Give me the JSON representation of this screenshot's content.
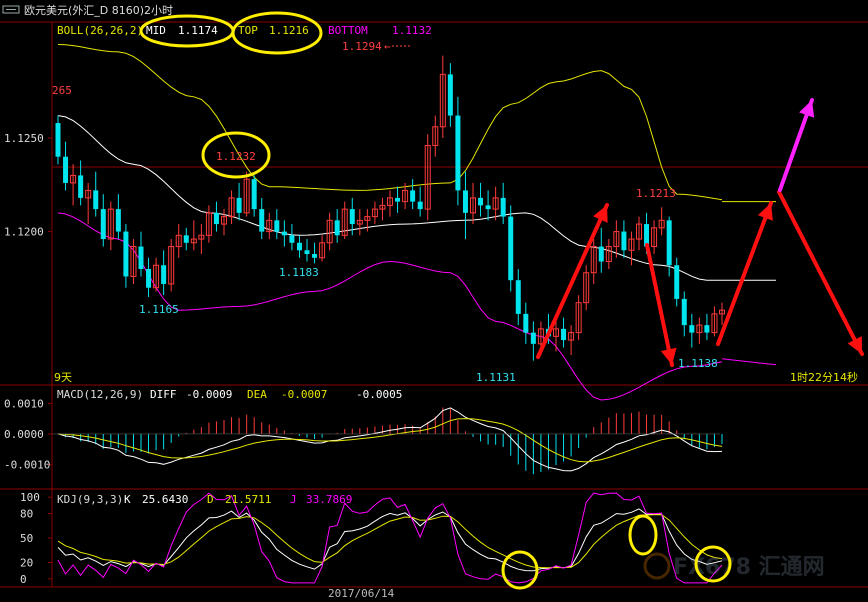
{
  "window": {
    "title": "欧元美元(外汇_D 8160)2小时",
    "icon": "window-toggle-icon"
  },
  "colors": {
    "background": "#000000",
    "panel_border": "#8b0000",
    "candle_up": "#ff3b3b",
    "candle_down": "#00e5ee",
    "boll_mid": "#ffffff",
    "boll_top": "#e6e600",
    "boll_bottom": "#ff00ff",
    "macd_diff": "#ffffff",
    "macd_dea": "#e6e600",
    "annotation": "#ffee00",
    "arrow_red": "#ff1010",
    "arrow_magenta": "#ff22ff"
  },
  "main_panel": {
    "indicator": "BOLL(26,26,2)",
    "mid_label": "MID",
    "mid_value": "1.1174",
    "top_label": "TOP",
    "top_value": "1.1216",
    "bottom_label": "BOTTOM",
    "bottom_value": "1.1132",
    "y_ticks": [
      "1.1250",
      "1.1200"
    ],
    "price_labels": [
      {
        "text": "1.1294",
        "kind": "high"
      },
      {
        "text": "265",
        "kind": "high"
      },
      {
        "text": "1.1232",
        "kind": "high"
      },
      {
        "text": "1.1213",
        "kind": "high"
      },
      {
        "text": "1.1183",
        "kind": "low"
      },
      {
        "text": "1.1165",
        "kind": "low"
      },
      {
        "text": "1.1131",
        "kind": "low"
      },
      {
        "text": "1.1138",
        "kind": "low"
      }
    ],
    "days_label": "9天",
    "countdown": "1时22分14秒",
    "high_marker_arrow": "←"
  },
  "macd_panel": {
    "indicator": "MACD(12,26,9)",
    "diff_label": "DIFF",
    "diff_value": "-0.0009",
    "dea_label": "DEA",
    "dea_value": "-0.0007",
    "macd_value": "-0.0005",
    "y_ticks": [
      "0.0010",
      "0.0000",
      "-0.0010"
    ]
  },
  "kdj_panel": {
    "indicator": "KDJ(9,3,3)",
    "k_label": "K",
    "k_value": "25.6430",
    "d_label": "D",
    "d_value": "21.5711",
    "j_label": "J",
    "j_value": "33.7869",
    "y_ticks": [
      "100",
      "80",
      "50",
      "20",
      "0"
    ]
  },
  "date_label": "2017/06/14",
  "watermark": "FX678 汇通网",
  "chart_data": [
    {
      "type": "candlestick",
      "panel": "main",
      "indicator": "BOLL(26,26,2)",
      "ylim": [
        1.1118,
        1.1312
      ],
      "ohlc": [
        [
          1.1258,
          1.1262,
          1.1236,
          1.124
        ],
        [
          1.124,
          1.1248,
          1.1222,
          1.1226
        ],
        [
          1.1226,
          1.1236,
          1.1214,
          1.123
        ],
        [
          1.123,
          1.1238,
          1.1214,
          1.1218
        ],
        [
          1.1218,
          1.1226,
          1.1204,
          1.1222
        ],
        [
          1.1222,
          1.1232,
          1.1208,
          1.1212
        ],
        [
          1.1212,
          1.122,
          1.1192,
          1.1196
        ],
        [
          1.1196,
          1.1216,
          1.119,
          1.1212
        ],
        [
          1.1212,
          1.122,
          1.1196,
          1.12
        ],
        [
          1.12,
          1.1204,
          1.117,
          1.1176
        ],
        [
          1.1176,
          1.1196,
          1.1172,
          1.1192
        ],
        [
          1.1192,
          1.12,
          1.1176,
          1.118
        ],
        [
          1.118,
          1.1186,
          1.1165,
          1.117
        ],
        [
          1.117,
          1.1186,
          1.1168,
          1.1182
        ],
        [
          1.1182,
          1.119,
          1.1166,
          1.1172
        ],
        [
          1.1172,
          1.1196,
          1.1168,
          1.1192
        ],
        [
          1.1192,
          1.1204,
          1.1186,
          1.1198
        ],
        [
          1.1198,
          1.1202,
          1.119,
          1.1194
        ],
        [
          1.1194,
          1.1206,
          1.119,
          1.1196
        ],
        [
          1.1196,
          1.1204,
          1.1188,
          1.1198
        ],
        [
          1.1198,
          1.1214,
          1.1194,
          1.121
        ],
        [
          1.121,
          1.1216,
          1.12,
          1.1204
        ],
        [
          1.1204,
          1.1212,
          1.1198,
          1.1208
        ],
        [
          1.1208,
          1.1222,
          1.1204,
          1.1218
        ],
        [
          1.1218,
          1.1226,
          1.1206,
          1.121
        ],
        [
          1.121,
          1.1232,
          1.1208,
          1.1228
        ],
        [
          1.1228,
          1.123,
          1.1208,
          1.1212
        ],
        [
          1.1212,
          1.1218,
          1.1196,
          1.12
        ],
        [
          1.12,
          1.121,
          1.1196,
          1.1206
        ],
        [
          1.1206,
          1.1212,
          1.1196,
          1.12
        ],
        [
          1.12,
          1.1206,
          1.1192,
          1.1198
        ],
        [
          1.1198,
          1.1204,
          1.119,
          1.1194
        ],
        [
          1.1194,
          1.1198,
          1.1186,
          1.119
        ],
        [
          1.119,
          1.1196,
          1.1184,
          1.1188
        ],
        [
          1.1188,
          1.1194,
          1.1183,
          1.1186
        ],
        [
          1.1186,
          1.1198,
          1.1184,
          1.1194
        ],
        [
          1.1194,
          1.121,
          1.119,
          1.1206
        ],
        [
          1.1206,
          1.1212,
          1.1194,
          1.1198
        ],
        [
          1.1198,
          1.1216,
          1.1196,
          1.1212
        ],
        [
          1.1212,
          1.1218,
          1.1198,
          1.1204
        ],
        [
          1.1204,
          1.1212,
          1.1198,
          1.1206
        ],
        [
          1.1206,
          1.1212,
          1.12,
          1.1208
        ],
        [
          1.1208,
          1.1216,
          1.1204,
          1.1212
        ],
        [
          1.1212,
          1.1218,
          1.1206,
          1.1214
        ],
        [
          1.1214,
          1.1222,
          1.1208,
          1.1218
        ],
        [
          1.1218,
          1.1224,
          1.121,
          1.1216
        ],
        [
          1.1216,
          1.1226,
          1.1212,
          1.1222
        ],
        [
          1.1222,
          1.1228,
          1.1212,
          1.1216
        ],
        [
          1.1216,
          1.1224,
          1.1208,
          1.1212
        ],
        [
          1.1212,
          1.1252,
          1.1206,
          1.1246
        ],
        [
          1.1246,
          1.1262,
          1.124,
          1.1256
        ],
        [
          1.1256,
          1.1294,
          1.125,
          1.1284
        ],
        [
          1.1284,
          1.129,
          1.1256,
          1.1262
        ],
        [
          1.1262,
          1.1272,
          1.1214,
          1.1222
        ],
        [
          1.1222,
          1.1232,
          1.1196,
          1.121
        ],
        [
          1.121,
          1.1226,
          1.1204,
          1.1218
        ],
        [
          1.1218,
          1.1226,
          1.1208,
          1.1214
        ],
        [
          1.1214,
          1.1222,
          1.1206,
          1.1212
        ],
        [
          1.1212,
          1.1224,
          1.1206,
          1.1218
        ],
        [
          1.1218,
          1.1226,
          1.1204,
          1.1208
        ],
        [
          1.1208,
          1.1214,
          1.1168,
          1.1174
        ],
        [
          1.1174,
          1.118,
          1.115,
          1.1156
        ],
        [
          1.1156,
          1.1162,
          1.114,
          1.1146
        ],
        [
          1.1146,
          1.1152,
          1.1131,
          1.114
        ],
        [
          1.114,
          1.1152,
          1.1134,
          1.1148
        ],
        [
          1.1148,
          1.1156,
          1.114,
          1.1144
        ],
        [
          1.1144,
          1.1152,
          1.1136,
          1.1148
        ],
        [
          1.1148,
          1.1154,
          1.1138,
          1.1142
        ],
        [
          1.1142,
          1.115,
          1.1134,
          1.1146
        ],
        [
          1.1146,
          1.1166,
          1.1142,
          1.1162
        ],
        [
          1.1162,
          1.1182,
          1.1158,
          1.1178
        ],
        [
          1.1178,
          1.1196,
          1.1172,
          1.1192
        ],
        [
          1.1192,
          1.1202,
          1.1178,
          1.1184
        ],
        [
          1.1184,
          1.1196,
          1.118,
          1.1192
        ],
        [
          1.1192,
          1.1206,
          1.1186,
          1.12
        ],
        [
          1.12,
          1.1206,
          1.1186,
          1.119
        ],
        [
          1.119,
          1.12,
          1.1182,
          1.1196
        ],
        [
          1.1196,
          1.1208,
          1.119,
          1.1204
        ],
        [
          1.1204,
          1.121,
          1.1188,
          1.1192
        ],
        [
          1.1192,
          1.1206,
          1.1188,
          1.1202
        ],
        [
          1.1202,
          1.1213,
          1.1198,
          1.1206
        ],
        [
          1.1206,
          1.1208,
          1.1176,
          1.1182
        ],
        [
          1.1182,
          1.1186,
          1.116,
          1.1164
        ],
        [
          1.1164,
          1.1168,
          1.1144,
          1.115
        ],
        [
          1.115,
          1.1156,
          1.1138,
          1.1146
        ],
        [
          1.1146,
          1.1154,
          1.114,
          1.115
        ],
        [
          1.115,
          1.1156,
          1.1142,
          1.1146
        ],
        [
          1.1146,
          1.116,
          1.1144,
          1.1156
        ],
        [
          1.1156,
          1.1162,
          1.115,
          1.1158
        ]
      ],
      "bands": {
        "mid": {
          "start": 1.1262,
          "end": 1.1174
        },
        "top": {
          "start": 1.13,
          "end": 1.1216
        },
        "bottom": {
          "start": 1.121,
          "end": 1.1132
        }
      }
    },
    {
      "type": "bar",
      "panel": "macd",
      "indicator": "MACD(12,26,9)",
      "ylim": [
        -0.0018,
        0.0016
      ],
      "values_summary": "histogram around zero line, green below / red above",
      "last": {
        "diff": -0.0009,
        "dea": -0.0007,
        "macd": -0.0005
      }
    },
    {
      "type": "line",
      "panel": "kdj",
      "indicator": "KDJ(9,3,3)",
      "ylim": [
        -10,
        110
      ],
      "last": {
        "k": 25.643,
        "d": 21.5711,
        "j": 33.7869
      }
    }
  ]
}
